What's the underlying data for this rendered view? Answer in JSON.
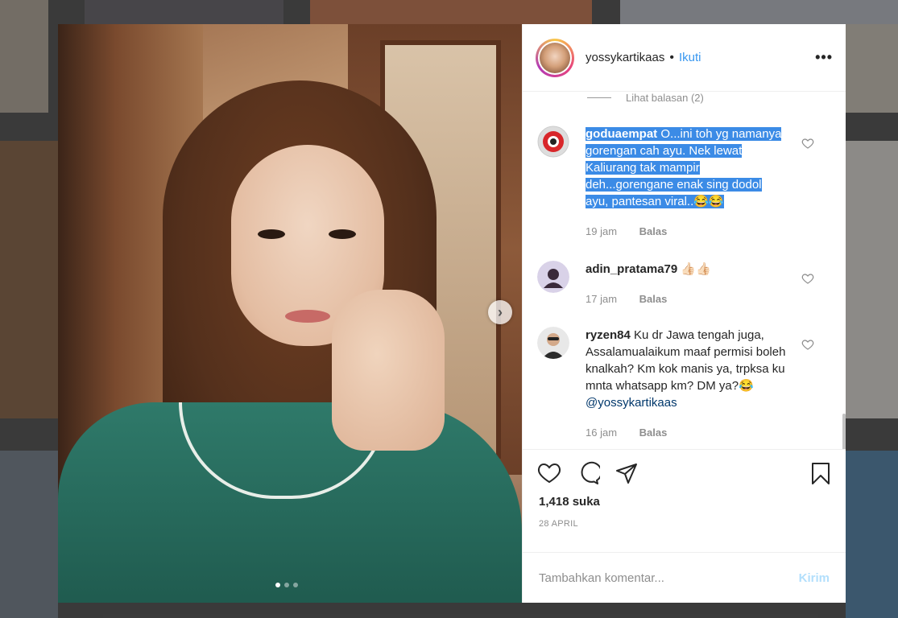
{
  "post": {
    "username": "yossykartikaas",
    "follow_label": "Ikuti",
    "separator": "•",
    "more_label": "•••",
    "next_label": "›",
    "carousel": {
      "total": 3,
      "active": 1
    }
  },
  "comments": {
    "view_replies_label": "Lihat balasan (2)",
    "items": [
      {
        "username": "goduaempat",
        "text": "O...ini toh yg namanya gorengan cah ayu. Nek lewat Kaliurang tak mampir deh...gorengane enak sing dodol ayu, pantesan viral..😂😂",
        "time": "19 jam",
        "reply_label": "Balas",
        "selected": true
      },
      {
        "username": "adin_pratama79",
        "text": "👍🏻👍🏻",
        "time": "17 jam",
        "reply_label": "Balas"
      },
      {
        "username": "ryzen84",
        "text": "Ku dr Jawa tengah juga, Assalamualaikum maaf permisi boleh knalkah? Km kok manis ya, trpksa ku mnta whatsapp km? DM ya?😂",
        "mention": "@yossykartikaas",
        "time": "16 jam",
        "reply_label": "Balas"
      }
    ]
  },
  "actions": {
    "likes": "1,418 suka",
    "date": "28 APRIL",
    "icons": [
      "heart-icon",
      "comment-icon",
      "share-icon",
      "bookmark-icon"
    ]
  },
  "composer": {
    "placeholder": "Tambahkan komentar...",
    "submit_label": "Kirim"
  },
  "colors": {
    "accent": "#3897f0",
    "selection": "#3b8be6",
    "muted": "#8e8e8e"
  }
}
